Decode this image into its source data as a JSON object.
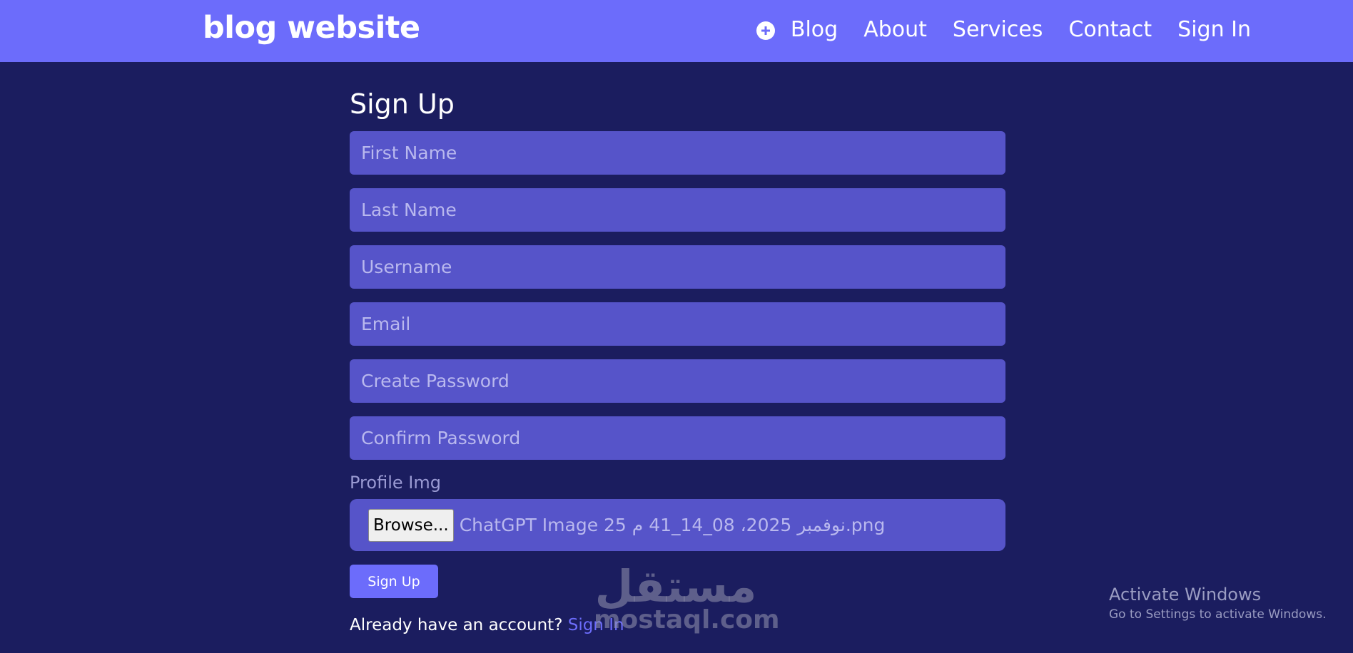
{
  "header": {
    "brand": "blog website",
    "nav": [
      {
        "label": "Blog"
      },
      {
        "label": "About"
      },
      {
        "label": "Services"
      },
      {
        "label": "Contact"
      },
      {
        "label": "Sign In"
      }
    ],
    "nav_icon": "plus-circle-icon"
  },
  "form": {
    "title": "Sign Up",
    "fields": {
      "first_name": {
        "placeholder": "First Name"
      },
      "last_name": {
        "placeholder": "Last Name"
      },
      "username": {
        "placeholder": "Username"
      },
      "email": {
        "placeholder": "Email"
      },
      "create_password": {
        "placeholder": "Create Password"
      },
      "confirm_password": {
        "placeholder": "Confirm Password"
      }
    },
    "profile_img": {
      "label": "Profile Img",
      "browse_label": "Browse...",
      "file_name": "ChatGPT Image 25 نوفمبر 2025، 08_14_41 م.png"
    },
    "submit_label": "Sign Up",
    "footer": {
      "prompt": "Already have an account?",
      "link": "Sign In"
    }
  },
  "watermark": {
    "arabic": "مستقل",
    "latin": "mostaql.com"
  },
  "windows_activation": {
    "title": "Activate Windows",
    "subtitle": "Go to Settings to activate Windows."
  },
  "colors": {
    "background": "#1b1d5f",
    "navbar": "#6c6cfb",
    "input": "#5654c9",
    "accent": "#6c6cfb"
  }
}
